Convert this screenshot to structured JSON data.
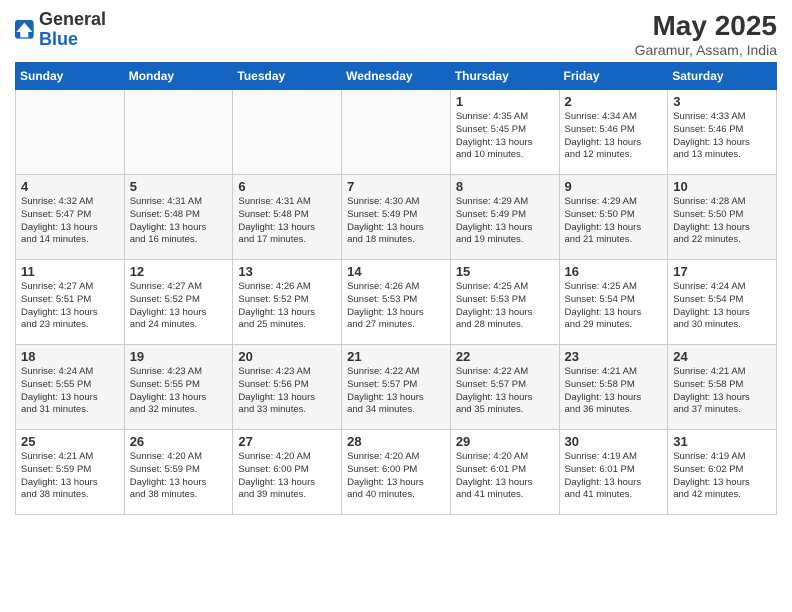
{
  "header": {
    "logo_general": "General",
    "logo_blue": "Blue",
    "month_title": "May 2025",
    "subtitle": "Garamur, Assam, India"
  },
  "days_of_week": [
    "Sunday",
    "Monday",
    "Tuesday",
    "Wednesday",
    "Thursday",
    "Friday",
    "Saturday"
  ],
  "weeks": [
    [
      {
        "day": "",
        "info": ""
      },
      {
        "day": "",
        "info": ""
      },
      {
        "day": "",
        "info": ""
      },
      {
        "day": "",
        "info": ""
      },
      {
        "day": "1",
        "info": "Sunrise: 4:35 AM\nSunset: 5:45 PM\nDaylight: 13 hours\nand 10 minutes."
      },
      {
        "day": "2",
        "info": "Sunrise: 4:34 AM\nSunset: 5:46 PM\nDaylight: 13 hours\nand 12 minutes."
      },
      {
        "day": "3",
        "info": "Sunrise: 4:33 AM\nSunset: 5:46 PM\nDaylight: 13 hours\nand 13 minutes."
      }
    ],
    [
      {
        "day": "4",
        "info": "Sunrise: 4:32 AM\nSunset: 5:47 PM\nDaylight: 13 hours\nand 14 minutes."
      },
      {
        "day": "5",
        "info": "Sunrise: 4:31 AM\nSunset: 5:48 PM\nDaylight: 13 hours\nand 16 minutes."
      },
      {
        "day": "6",
        "info": "Sunrise: 4:31 AM\nSunset: 5:48 PM\nDaylight: 13 hours\nand 17 minutes."
      },
      {
        "day": "7",
        "info": "Sunrise: 4:30 AM\nSunset: 5:49 PM\nDaylight: 13 hours\nand 18 minutes."
      },
      {
        "day": "8",
        "info": "Sunrise: 4:29 AM\nSunset: 5:49 PM\nDaylight: 13 hours\nand 19 minutes."
      },
      {
        "day": "9",
        "info": "Sunrise: 4:29 AM\nSunset: 5:50 PM\nDaylight: 13 hours\nand 21 minutes."
      },
      {
        "day": "10",
        "info": "Sunrise: 4:28 AM\nSunset: 5:50 PM\nDaylight: 13 hours\nand 22 minutes."
      }
    ],
    [
      {
        "day": "11",
        "info": "Sunrise: 4:27 AM\nSunset: 5:51 PM\nDaylight: 13 hours\nand 23 minutes."
      },
      {
        "day": "12",
        "info": "Sunrise: 4:27 AM\nSunset: 5:52 PM\nDaylight: 13 hours\nand 24 minutes."
      },
      {
        "day": "13",
        "info": "Sunrise: 4:26 AM\nSunset: 5:52 PM\nDaylight: 13 hours\nand 25 minutes."
      },
      {
        "day": "14",
        "info": "Sunrise: 4:26 AM\nSunset: 5:53 PM\nDaylight: 13 hours\nand 27 minutes."
      },
      {
        "day": "15",
        "info": "Sunrise: 4:25 AM\nSunset: 5:53 PM\nDaylight: 13 hours\nand 28 minutes."
      },
      {
        "day": "16",
        "info": "Sunrise: 4:25 AM\nSunset: 5:54 PM\nDaylight: 13 hours\nand 29 minutes."
      },
      {
        "day": "17",
        "info": "Sunrise: 4:24 AM\nSunset: 5:54 PM\nDaylight: 13 hours\nand 30 minutes."
      }
    ],
    [
      {
        "day": "18",
        "info": "Sunrise: 4:24 AM\nSunset: 5:55 PM\nDaylight: 13 hours\nand 31 minutes."
      },
      {
        "day": "19",
        "info": "Sunrise: 4:23 AM\nSunset: 5:55 PM\nDaylight: 13 hours\nand 32 minutes."
      },
      {
        "day": "20",
        "info": "Sunrise: 4:23 AM\nSunset: 5:56 PM\nDaylight: 13 hours\nand 33 minutes."
      },
      {
        "day": "21",
        "info": "Sunrise: 4:22 AM\nSunset: 5:57 PM\nDaylight: 13 hours\nand 34 minutes."
      },
      {
        "day": "22",
        "info": "Sunrise: 4:22 AM\nSunset: 5:57 PM\nDaylight: 13 hours\nand 35 minutes."
      },
      {
        "day": "23",
        "info": "Sunrise: 4:21 AM\nSunset: 5:58 PM\nDaylight: 13 hours\nand 36 minutes."
      },
      {
        "day": "24",
        "info": "Sunrise: 4:21 AM\nSunset: 5:58 PM\nDaylight: 13 hours\nand 37 minutes."
      }
    ],
    [
      {
        "day": "25",
        "info": "Sunrise: 4:21 AM\nSunset: 5:59 PM\nDaylight: 13 hours\nand 38 minutes."
      },
      {
        "day": "26",
        "info": "Sunrise: 4:20 AM\nSunset: 5:59 PM\nDaylight: 13 hours\nand 38 minutes."
      },
      {
        "day": "27",
        "info": "Sunrise: 4:20 AM\nSunset: 6:00 PM\nDaylight: 13 hours\nand 39 minutes."
      },
      {
        "day": "28",
        "info": "Sunrise: 4:20 AM\nSunset: 6:00 PM\nDaylight: 13 hours\nand 40 minutes."
      },
      {
        "day": "29",
        "info": "Sunrise: 4:20 AM\nSunset: 6:01 PM\nDaylight: 13 hours\nand 41 minutes."
      },
      {
        "day": "30",
        "info": "Sunrise: 4:19 AM\nSunset: 6:01 PM\nDaylight: 13 hours\nand 41 minutes."
      },
      {
        "day": "31",
        "info": "Sunrise: 4:19 AM\nSunset: 6:02 PM\nDaylight: 13 hours\nand 42 minutes."
      }
    ]
  ]
}
